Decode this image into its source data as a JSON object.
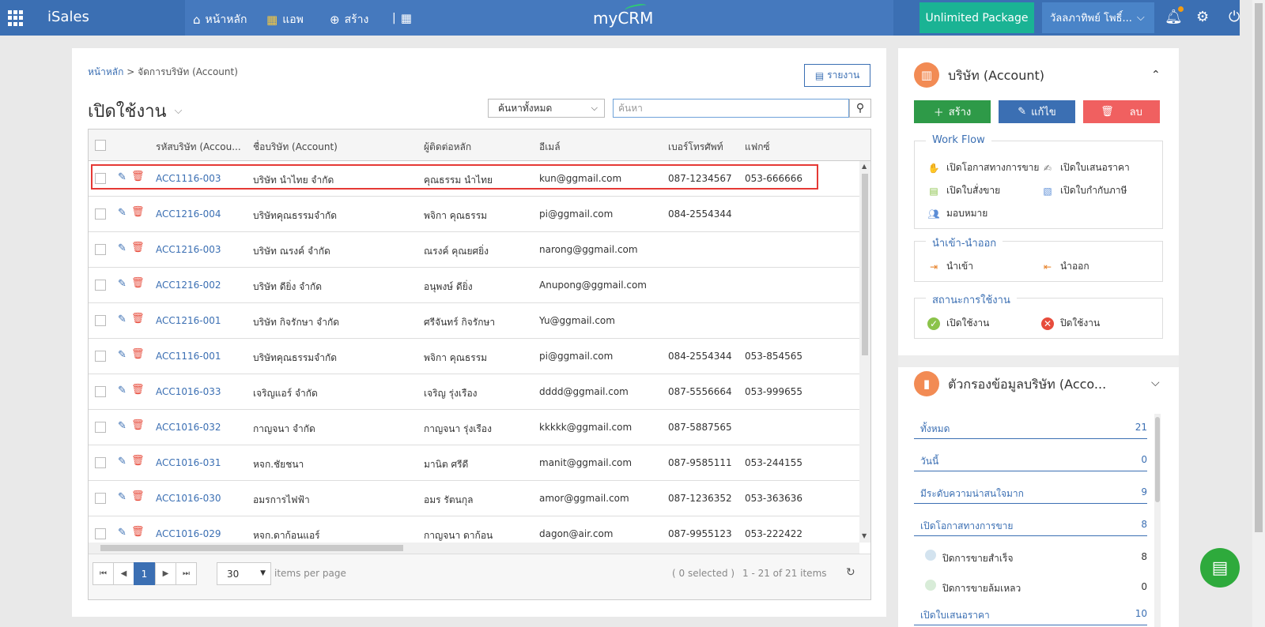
{
  "topbar": {
    "brand": "iSales",
    "nav": [
      {
        "icon": "home-icon",
        "label": "หน้าหลัก"
      },
      {
        "icon": "apps-grid-icon",
        "label": "แอพ"
      },
      {
        "icon": "plus-circle-icon",
        "label": "สร้าง"
      }
    ],
    "logo": "myCRM",
    "package": "Unlimited Package",
    "user": "วัลลภาทิพย์ โพธิ์...",
    "colors": {
      "bar": "#3b6fb3",
      "package": "#1ab394",
      "notification": "#f39c12"
    }
  },
  "main": {
    "breadcrumb": {
      "home": "หน้าหลัก",
      "separator": ">",
      "current": "จัดการบริษัท (Account)"
    },
    "report_label": "รายงาน",
    "view_title": "เปิดใช้งาน",
    "search_scope": "ค้นหาทั้งหมด",
    "search_placeholder": "ค้นหา",
    "columns": [
      "รหัสบริษัท (Accou...",
      "ชื่อบริษัท (Account)",
      "ผู้ติดต่อหลัก",
      "อีเมล์",
      "เบอร์โทรศัพท์",
      "แฟกซ์"
    ],
    "rows": [
      {
        "code": "ACC1116-003",
        "name": "บริษัท นำไทย จำกัด",
        "contact": "คุณธรรม นำไทย",
        "email": "kun@ggmail.com",
        "phone": "087-1234567",
        "fax": "053-666666"
      },
      {
        "code": "ACC1216-004",
        "name": "บริษัทคุณธรรมจำกัด",
        "contact": "พจิกา คุณธรรม",
        "email": "pi@ggmail.com",
        "phone": "084-2554344",
        "fax": ""
      },
      {
        "code": "ACC1216-003",
        "name": "บริษัท ณรงค์ จำกัด",
        "contact": "ณรงค์ คุณยศยิ่ง",
        "email": "narong@ggmail.com",
        "phone": "",
        "fax": ""
      },
      {
        "code": "ACC1216-002",
        "name": "บริษัท ดียิ่ง จำกัด",
        "contact": "อนุพงษ์ ดียิ่ง",
        "email": "Anupong@ggmail.com",
        "phone": "",
        "fax": ""
      },
      {
        "code": "ACC1216-001",
        "name": "บริษัท กิจรักษา จำกัด",
        "contact": "ศรีจันทร์ กิจรักษา",
        "email": "Yu@ggmail.com",
        "phone": "",
        "fax": ""
      },
      {
        "code": "ACC1116-001",
        "name": "บริษัทคุณธรรมจำกัด",
        "contact": "พจิกา คุณธรรม",
        "email": "pi@ggmail.com",
        "phone": "084-2554344",
        "fax": "053-854565"
      },
      {
        "code": "ACC1016-033",
        "name": "เจริญแอร์ จำกัด",
        "contact": "เจริญ รุ่งเรือง",
        "email": "dddd@ggmail.com",
        "phone": "087-5556664",
        "fax": "053-999655"
      },
      {
        "code": "ACC1016-032",
        "name": "กาญจนา จำกัด",
        "contact": "กาญจนา รุ่งเรือง",
        "email": "kkkkk@ggmail.com",
        "phone": "087-5887565",
        "fax": ""
      },
      {
        "code": "ACC1016-031",
        "name": "หจก.ชัยชนา",
        "contact": "มานิต ศรีดี",
        "email": "manit@ggmail.com",
        "phone": "087-9585111",
        "fax": "053-244155"
      },
      {
        "code": "ACC1016-030",
        "name": "อมรการไฟฟ้า",
        "contact": "อมร รัตนกุล",
        "email": "amor@ggmail.com",
        "phone": "087-1236352",
        "fax": "053-363636"
      },
      {
        "code": "ACC1016-029",
        "name": "หจก.ดาก้อนแอร์",
        "contact": "กาญจนา ดาก้อน",
        "email": "dagon@air.com",
        "phone": "087-9955123",
        "fax": "053-222422"
      }
    ],
    "pager": {
      "page": "1",
      "per_page": "30",
      "per_page_label": "items per page",
      "selected": "( 0 selected )",
      "range": "1 - 21 of 21 items"
    }
  },
  "side": {
    "account": {
      "title": "บริษัท (Account)",
      "buttons": [
        {
          "label": "สร้าง",
          "icon": "plus-icon",
          "color": "#2e9a48"
        },
        {
          "label": "แก้ไข",
          "icon": "pencil-icon",
          "color": "#3b6fb3"
        },
        {
          "label": "ลบ",
          "icon": "trash-icon",
          "color": "#f06060"
        }
      ],
      "workflow": {
        "legend": "Work Flow",
        "items": [
          "เปิดโอกาสทางการขาย",
          "เปิดใบเสนอราคา",
          "เปิดใบสั่งขาย",
          "เปิดใบกำกับภาษี",
          "มอบหมาย"
        ]
      },
      "io": {
        "legend": "นำเข้า-นำออก",
        "items": [
          "นำเข้า",
          "นำออก"
        ]
      },
      "status": {
        "legend": "สถานะการใช้งาน",
        "items": [
          "เปิดใช้งาน",
          "ปิดใช้งาน"
        ]
      }
    },
    "filter": {
      "title": "ตัวกรองข้อมูลบริษัท (Acco...",
      "items": [
        {
          "label": "ทั้งหมด",
          "count": "21"
        },
        {
          "label": "วันนี้",
          "count": "0"
        },
        {
          "label": "มีระดับความน่าสนใจมาก",
          "count": "9"
        },
        {
          "label": "เปิดโอกาสทางการขาย",
          "count": "8"
        }
      ],
      "sub_items": [
        {
          "label": "ปิดการขายสำเร็จ",
          "count": "8",
          "color": "#d3e3ef"
        },
        {
          "label": "ปิดการขายล้มเหลว",
          "count": "0",
          "color": "#d8ecd8"
        }
      ],
      "tail": {
        "label": "เปิดใบเสนอราคา",
        "count": "10"
      }
    }
  }
}
